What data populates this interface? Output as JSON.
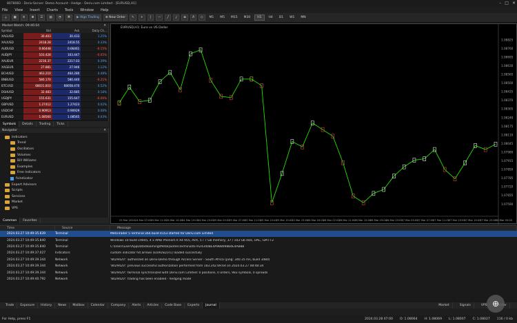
{
  "window": {
    "title": "8078083 - Deriv-Server: Demo Account - Hedge - Deriv.com Limited - [EURUSD,H1]",
    "controls": [
      "–",
      "□",
      "✕"
    ]
  },
  "menu": [
    "File",
    "View",
    "Insert",
    "Charts",
    "Tools",
    "Window",
    "Help"
  ],
  "toolbar": {
    "algo_label": "Algo Trading",
    "order_label": "New Order",
    "timeframes": [
      "M1",
      "M5",
      "M15",
      "M30",
      "H1",
      "H4",
      "D1",
      "W1",
      "MN"
    ],
    "active_timeframe": "H1"
  },
  "market_watch": {
    "title": "Market Watch: 09:46:04",
    "headers": [
      "Symbol",
      "Bid",
      "Ask",
      "Daily Ch..."
    ],
    "rows": [
      {
        "symbol": "XAGUSD",
        "bid": "30.403",
        "ask": "30.433",
        "chg": "1.25%",
        "dir": "up"
      },
      {
        "symbol": "XAUUSD",
        "bid": "2418.28",
        "ask": "2418.55",
        "chg": "0.33%",
        "dir": "up"
      },
      {
        "symbol": "AUDUSD",
        "bid": "0.66448",
        "ask": "0.66461",
        "chg": "-0.15%",
        "dir": "down"
      },
      {
        "symbol": "AUDJPY",
        "bid": "103.428",
        "ask": "103.447",
        "chg": "-0.05%",
        "dir": "down"
      },
      {
        "symbol": "XAUEUR",
        "bid": "2216.37",
        "ask": "2217.03",
        "chg": "0.39%",
        "dir": "up"
      },
      {
        "symbol": "XAGEUR",
        "bid": "27.881",
        "ask": "27.946",
        "chg": "1.12%",
        "dir": "up"
      },
      {
        "symbol": "BCHUSD",
        "bid": "463.210",
        "ask": "464.280",
        "chg": "0.48%",
        "dir": "up"
      },
      {
        "symbol": "BNBUSD",
        "bid": "580.170",
        "ask": "580.440",
        "chg": "-0.21%",
        "dir": "down"
      },
      {
        "symbol": "BTCUSD",
        "bid": "68031.810",
        "ask": "68058.470",
        "chg": "0.52%",
        "dir": "up"
      },
      {
        "symbol": "DSHUSD",
        "bid": "32.483",
        "ask": "32.685",
        "chg": "0.18%",
        "dir": "up"
      },
      {
        "symbol": "USDJPY",
        "bid": "155.631",
        "ask": "155.647",
        "chg": "-0.06%",
        "dir": "down"
      },
      {
        "symbol": "GBPUSD",
        "bid": "1.27412",
        "ask": "1.27423",
        "chg": "0.02%",
        "dir": "up"
      },
      {
        "symbol": "USDCHF",
        "bid": "0.90913",
        "ask": "0.90929",
        "chg": "0.08%",
        "dir": "up"
      },
      {
        "symbol": "EURUSD",
        "bid": "1.08560",
        "ask": "1.08565",
        "chg": "0.03%",
        "dir": "up"
      }
    ],
    "tabs": [
      "Symbols",
      "Details",
      "Trading",
      "Ticks"
    ]
  },
  "navigator": {
    "title": "Navigator",
    "items": [
      {
        "label": "Indicators",
        "level": 1,
        "icon": "folder"
      },
      {
        "label": "Trend",
        "level": 2,
        "icon": "folder"
      },
      {
        "label": "Oscillators",
        "level": 2,
        "icon": "folder"
      },
      {
        "label": "Volumes",
        "level": 2,
        "icon": "folder"
      },
      {
        "label": "Bill Williams",
        "level": 2,
        "icon": "folder"
      },
      {
        "label": "Examples",
        "level": 2,
        "icon": "folder"
      },
      {
        "label": "Free Indicators",
        "level": 2,
        "icon": "folder"
      },
      {
        "label": "fvindicator",
        "level": 2,
        "icon": "cube"
      },
      {
        "label": "Expert Advisors",
        "level": 1,
        "icon": "folder"
      },
      {
        "label": "Scripts",
        "level": 1,
        "icon": "folder"
      },
      {
        "label": "Services",
        "level": 1,
        "icon": "folder"
      },
      {
        "label": "Market",
        "level": 1,
        "icon": "folder"
      },
      {
        "label": "VPS",
        "level": 1,
        "icon": "folder"
      }
    ],
    "tabs": [
      "Common",
      "Favorites"
    ]
  },
  "chart": {
    "symbol_label": "EURUSD,H1: Euro vs US Dollar"
  },
  "chart_data": {
    "type": "line",
    "x": [
      "23 Mar 2024",
      "24 Mar 07:00",
      "24 Mar 11:00",
      "24 Mar 15:00",
      "24 Mar 19:00",
      "24 Mar 23:00",
      "25 Mar 03:00",
      "25 Mar 07:00",
      "25 Mar 11:00",
      "25 Mar 15:00",
      "25 Mar 19:00",
      "25 Mar 23:00",
      "26 Mar 03:00",
      "26 Mar 07:00",
      "26 Mar 11:00",
      "26 Mar 15:00",
      "26 Mar 19:00",
      "26 Mar 23:00",
      "27 Mar 03:00",
      "27 Mar 07:00",
      "27 Mar 11:00",
      "27 Mar 15:00",
      "27 Mar 19:00",
      "27 Mar 23:00",
      "28 Mar 03:00"
    ],
    "series": [
      {
        "values": [
          1.0835,
          1.0847,
          1.0836,
          1.0837,
          1.0851,
          1.0858,
          1.0845,
          1.0872,
          1.0875,
          1.0852,
          1.084,
          1.0839,
          1.0853,
          1.0853,
          1.0848,
          1.076,
          1.0782,
          1.0806,
          1.0802,
          1.082,
          1.0815,
          1.081,
          1.079,
          1.0765,
          1.076,
          1.0767,
          1.077,
          1.078,
          1.0787,
          1.0792,
          1.0793,
          1.08,
          1.0785,
          1.0778,
          1.079,
          1.0803,
          1.08,
          1.0804
        ]
      }
    ],
    "y_ticks": [
      "1.08825",
      "1.08760",
      "1.08695",
      "1.08630",
      "1.08565",
      "1.08500",
      "1.08435",
      "1.08370",
      "1.08305",
      "1.08240",
      "1.08175",
      "1.08110",
      "1.08045",
      "1.07980",
      "1.07915",
      "1.07850",
      "1.07785",
      "1.07720",
      "1.07655",
      "1.07590"
    ],
    "ylim": [
      1.0755,
      1.0885
    ],
    "line_color": "#22e000",
    "marker_colors": {
      "up": "#e6e6e6",
      "down": "#d94545",
      "doji": "#e0c040"
    },
    "grid": false
  },
  "toolbox": {
    "headers": [
      "Time",
      "Source",
      "Message"
    ],
    "rows": [
      {
        "time": "2024.03.27 10:49:35.839",
        "source": "Terminal",
        "message": "MetaTrader 5 Terminal x64 build 4153 started for Deriv.com Limited"
      },
      {
        "time": "2024.03.27 10:49:35.840",
        "source": "Terminal",
        "message": "Windows 10 build 19045, 4 x AMD Phenom II X4 955, AVX, 5 / 7 Gb memory, 37 / 103 Gb disk, UAC, GMT+2"
      },
      {
        "time": "2024.03.27 10:49:35.840",
        "source": "Terminal",
        "message": "C:\\Users\\user\\AppData\\Roaming\\MetaQuotes\\Terminal\\67A24340BE4A988098B4E4AB8B"
      },
      {
        "time": "2024.03.27 10:49:37.027",
        "source": "Indicators",
        "message": "custom indicator fvt.arrows (EURUSD,H1) loaded succesfully"
      },
      {
        "time": "2024.03.27 10:49:39.344",
        "source": "Network",
        "message": "'8029420': authorized on Deriv-Demo through Access Server - South Africa (ping: 340.35 ms, build 3480)"
      },
      {
        "time": "2024.03.27 10:49:39.344",
        "source": "Network",
        "message": "'8029420': previous successful authorization performed from 183.242.69.64 on 2024.03.27 08:48:34"
      },
      {
        "time": "2024.03.27 10:49:39.344",
        "source": "Network",
        "message": "'8029420': terminal synchronized with Deriv.com Limited: 0 positions, 0 orders, 983 symbols, 0 spreads"
      },
      {
        "time": "2024.03.27 10:49:40.792",
        "source": "Network",
        "message": "'8029420': trading has been enabled - hedging mode"
      }
    ],
    "tabs": [
      "Trade",
      "Exposure",
      "History",
      "News",
      "Mailbox",
      "Calendar",
      "Company",
      "Alerts",
      "Articles",
      "Code Base",
      "Experts",
      "Journal"
    ],
    "active_tab": "Journal",
    "right_items": [
      "Market",
      "Signals",
      "VPS",
      "Tester"
    ]
  },
  "status": {
    "left": "For Help, press F1",
    "date": "2024.03.28 07:00",
    "o": "O: 1.08064",
    "h": "H: 1.08069",
    "l": "L: 1.08007",
    "c": "C: 1.08027",
    "bars": "116 / 0 kb"
  }
}
